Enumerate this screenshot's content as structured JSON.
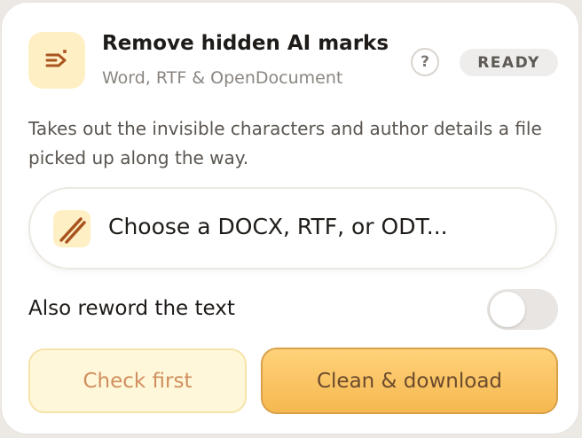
{
  "header": {
    "title": "Remove hidden AI marks",
    "subtitle": "Word, RTF & OpenDocument",
    "icon": "wand-sparkle-icon"
  },
  "help": {
    "label": "?"
  },
  "status": {
    "label": "READY"
  },
  "description": "Takes out the invisible characters and author details a file picked up along the way.",
  "file_picker": {
    "label": "Choose a DOCX, RTF, or ODT...",
    "icon": "striped-file-icon"
  },
  "reword": {
    "label": "Also reword the text",
    "enabled": false
  },
  "actions": {
    "check_label": "Check first",
    "clean_label": "Clean & download"
  },
  "colors": {
    "accent": "#f6b850",
    "accent_light": "#ffefc4",
    "icon_brown": "#a9541f"
  }
}
